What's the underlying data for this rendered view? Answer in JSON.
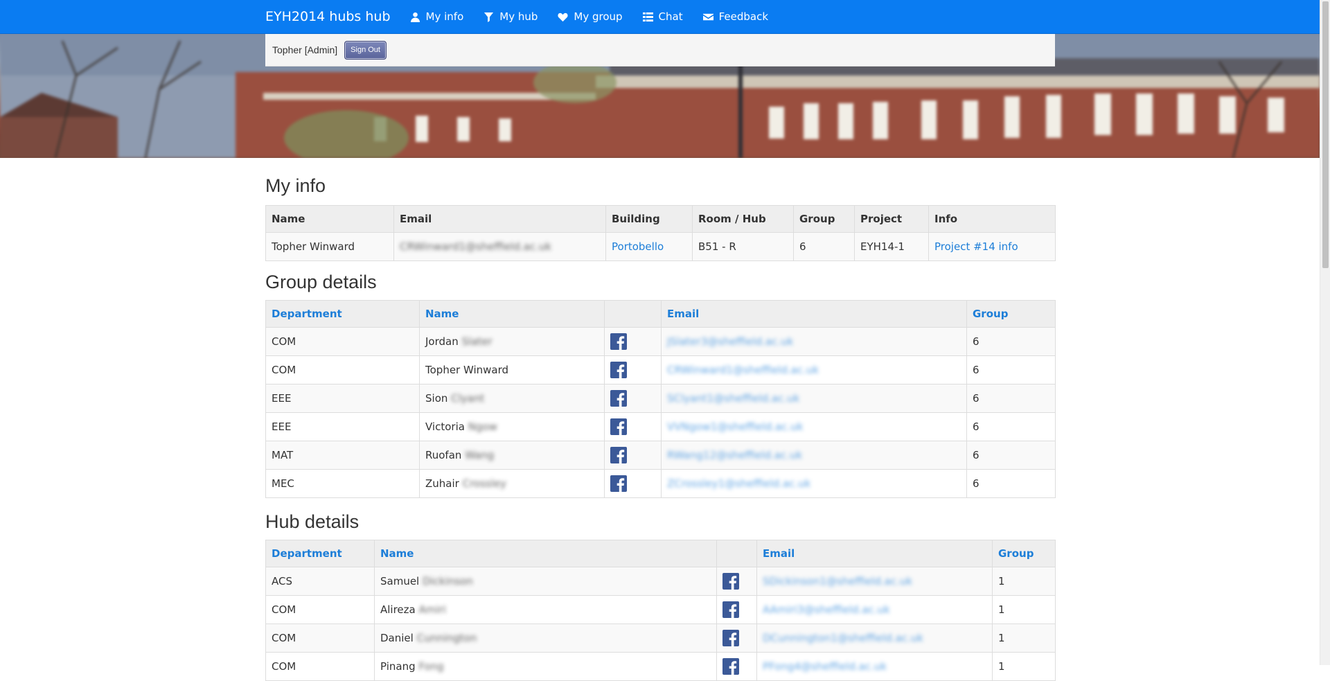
{
  "nav": {
    "brand": "EYH2014 hubs hub",
    "items": [
      {
        "label": "My info",
        "icon": "user-icon"
      },
      {
        "label": "My hub",
        "icon": "filter-icon"
      },
      {
        "label": "My group",
        "icon": "heart-icon"
      },
      {
        "label": "Chat",
        "icon": "list-icon"
      },
      {
        "label": "Feedback",
        "icon": "envelope-icon"
      }
    ],
    "color": "#0a7cf2"
  },
  "session": {
    "user_label": "Topher [Admin]",
    "signout_label": "Sign Out"
  },
  "my_info": {
    "title": "My info",
    "headers": [
      "Name",
      "Email",
      "Building",
      "Room / Hub",
      "Group",
      "Project",
      "Info"
    ],
    "row": {
      "name": "Topher Winward",
      "email": "CRWinward1@sheffield.ac.uk",
      "building": "Portobello",
      "room": "B51 - R",
      "group": "6",
      "project": "EYH14-1",
      "info": "Project #14 info"
    }
  },
  "group_details": {
    "title": "Group details",
    "headers": [
      "Department",
      "Name",
      "",
      "Email",
      "Group"
    ],
    "rows": [
      {
        "dept": "COM",
        "first": "Jordan",
        "last": "Slater",
        "email": "JSlater3@sheffield.ac.uk",
        "group": "6"
      },
      {
        "dept": "COM",
        "first": "Topher Winward",
        "last": "",
        "email": "CRWinward1@sheffield.ac.uk",
        "group": "6"
      },
      {
        "dept": "EEE",
        "first": "Sion",
        "last": "Clyant",
        "email": "SClyant1@sheffield.ac.uk",
        "group": "6"
      },
      {
        "dept": "EEE",
        "first": "Victoria",
        "last": "Ngow",
        "email": "VVNgow1@sheffield.ac.uk",
        "group": "6"
      },
      {
        "dept": "MAT",
        "first": "Ruofan",
        "last": "Wang",
        "email": "RWang12@sheffield.ac.uk",
        "group": "6"
      },
      {
        "dept": "MEC",
        "first": "Zuhair",
        "last": "Crossley",
        "email": "ZCrossley1@sheffield.ac.uk",
        "group": "6"
      }
    ]
  },
  "hub_details": {
    "title": "Hub details",
    "headers": [
      "Department",
      "Name",
      "",
      "Email",
      "Group"
    ],
    "rows": [
      {
        "dept": "ACS",
        "first": "Samuel",
        "last": "Dickinson",
        "email": "SDickinson1@sheffield.ac.uk",
        "group": "1"
      },
      {
        "dept": "COM",
        "first": "Alireza",
        "last": "Amiri",
        "email": "AAmiri3@sheffield.ac.uk",
        "group": "1"
      },
      {
        "dept": "COM",
        "first": "Daniel",
        "last": "Cunnington",
        "email": "DCunnington1@sheffield.ac.uk",
        "group": "1"
      },
      {
        "dept": "COM",
        "first": "Pinang",
        "last": "Fong",
        "email": "PFong4@sheffield.ac.uk",
        "group": "1"
      }
    ]
  }
}
